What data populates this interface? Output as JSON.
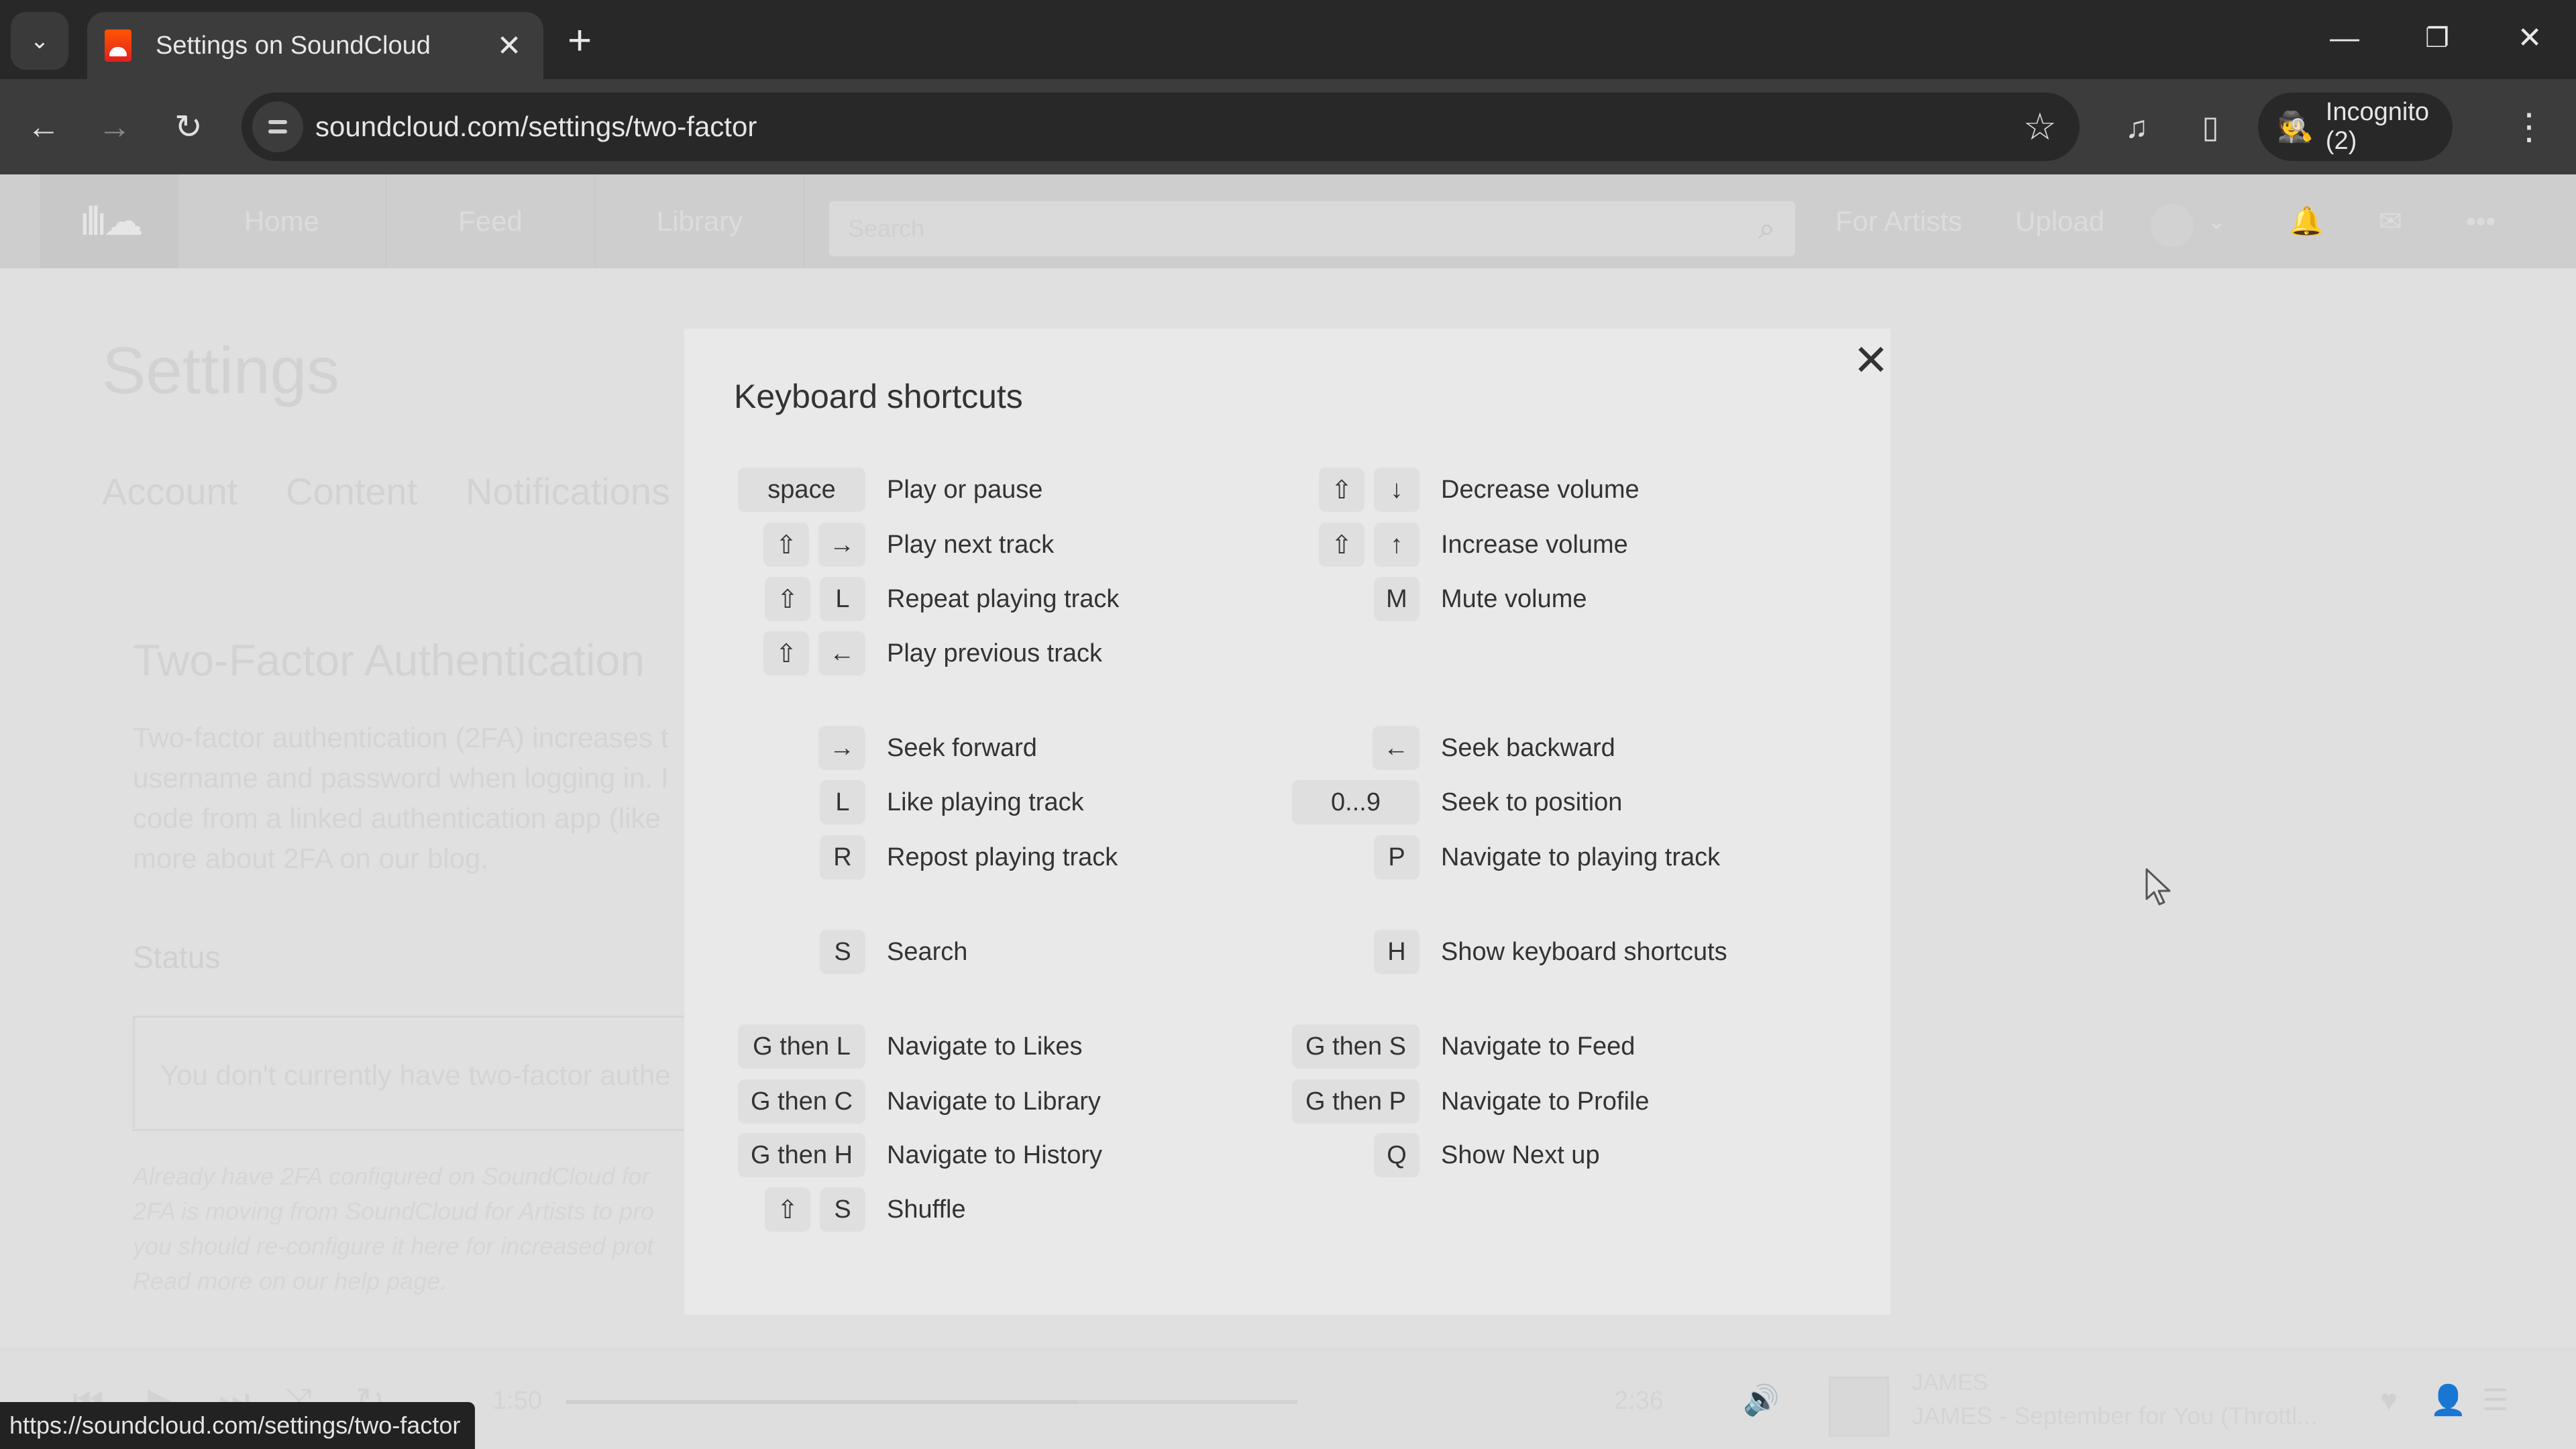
{
  "browser": {
    "tab": {
      "title": "Settings on SoundCloud",
      "close": "✕"
    },
    "new_tab": "+",
    "window_controls": {
      "minimize": "—",
      "restore": "❐",
      "close": "✕"
    },
    "nav": {
      "back": "←",
      "forward": "→",
      "reload": "↻"
    },
    "address": "soundcloud.com/settings/two-factor",
    "bookmark_icon": "☆",
    "media_icon": "♫",
    "sidepanel_icon": "▯",
    "profile": {
      "label": "Incognito (2)",
      "icon": "🕵"
    },
    "menu_icon": "⋮",
    "status_url": "https://soundcloud.com/settings/two-factor"
  },
  "header": {
    "logo": "ıllı☁",
    "nav": [
      "Home",
      "Feed",
      "Library"
    ],
    "search_placeholder": "Search",
    "search_icon": "⌕",
    "right_links": [
      "For Artists",
      "Upload"
    ],
    "avatar_caret": "⌄",
    "notifications_icon": "🔔",
    "messages_icon": "✉",
    "more_icon": "•••"
  },
  "settings": {
    "title": "Settings",
    "tabs": [
      "Account",
      "Content",
      "Notifications"
    ],
    "section_title": "Two-Factor Authentication",
    "description_lines": [
      "Two-factor authentication (2FA) increases t",
      "username and password when logging in. I",
      "code from a linked authentication app (like",
      "more about 2FA on our blog."
    ],
    "status_label": "Status",
    "status_text": "You don't currently have two-factor authe",
    "note_lines": [
      "Already have 2FA configured on SoundCloud for",
      "2FA is moving from SoundCloud for Artists to pro",
      "you should re-configure it here for increased prot",
      "Read more on our help page."
    ]
  },
  "player": {
    "controls": {
      "prev": "⏮",
      "play": "▶",
      "next": "⏭",
      "shuffle": "⤨",
      "repeat": "↻"
    },
    "elapsed": "1:50",
    "duration": "2:36",
    "progress_fraction": 0.7,
    "volume_icon": "🔊",
    "artist": "JAMES",
    "track": "JAMES - September for You (Throttl...",
    "like_icon": "♥",
    "follow_icon": "👤",
    "queue_icon": "☰"
  },
  "modal": {
    "title": "Keyboard shortcuts",
    "close": "✕",
    "left": [
      {
        "keys": [
          "space"
        ],
        "desc": "Play or pause"
      },
      {
        "keys": [
          "⇧",
          "→"
        ],
        "desc": "Play next track"
      },
      {
        "keys": [
          "⇧",
          "L"
        ],
        "desc": "Repeat playing track"
      },
      {
        "keys": [
          "⇧",
          "←"
        ],
        "desc": "Play previous track"
      },
      {
        "keys": [
          "→"
        ],
        "desc": "Seek forward"
      },
      {
        "keys": [
          "L"
        ],
        "desc": "Like playing track"
      },
      {
        "keys": [
          "R"
        ],
        "desc": "Repost playing track"
      },
      {
        "keys": [
          "S"
        ],
        "desc": "Search"
      },
      {
        "keys": [
          "G then L"
        ],
        "desc": "Navigate to Likes"
      },
      {
        "keys": [
          "G then C"
        ],
        "desc": "Navigate to Library"
      },
      {
        "keys": [
          "G then H"
        ],
        "desc": "Navigate to History"
      },
      {
        "keys": [
          "⇧",
          "S"
        ],
        "desc": "Shuffle"
      }
    ],
    "right": [
      {
        "keys": [
          "⇧",
          "↓"
        ],
        "desc": "Decrease volume"
      },
      {
        "keys": [
          "⇧",
          "↑"
        ],
        "desc": "Increase volume"
      },
      {
        "keys": [
          "M"
        ],
        "desc": "Mute volume"
      },
      {
        "keys": [
          "←"
        ],
        "desc": "Seek backward"
      },
      {
        "keys": [
          "0...9"
        ],
        "desc": "Seek to position"
      },
      {
        "keys": [
          "P"
        ],
        "desc": "Navigate to playing track"
      },
      {
        "keys": [
          "H"
        ],
        "desc": "Show keyboard shortcuts"
      },
      {
        "keys": [
          "G then S"
        ],
        "desc": "Navigate to Feed"
      },
      {
        "keys": [
          "G then P"
        ],
        "desc": "Navigate to Profile"
      },
      {
        "keys": [
          "Q"
        ],
        "desc": "Show Next up"
      }
    ]
  }
}
